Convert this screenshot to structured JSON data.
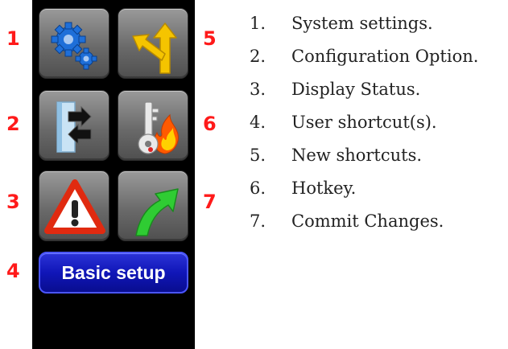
{
  "panel": {
    "buttons": [
      {
        "icon": "gears-icon",
        "number": "1"
      },
      {
        "icon": "split-arrow-icon",
        "number": "5"
      },
      {
        "icon": "transfer-arrows-icon",
        "number": "2"
      },
      {
        "icon": "key-fire-icon",
        "number": "6"
      },
      {
        "icon": "warning-icon",
        "number": "3"
      },
      {
        "icon": "green-arrow-icon",
        "number": "7"
      }
    ],
    "basic_setup": {
      "label": "Basic setup",
      "number": "4"
    }
  },
  "legend": [
    {
      "index": "1.",
      "text": "System settings."
    },
    {
      "index": "2.",
      "text": "Configuration Option."
    },
    {
      "index": "3.",
      "text": "Display Status."
    },
    {
      "index": "4.",
      "text": "User shortcut(s)."
    },
    {
      "index": "5.",
      "text": "New shortcuts."
    },
    {
      "index": "6.",
      "text": "Hotkey."
    },
    {
      "index": "7.",
      "text": "Commit Changes."
    }
  ],
  "colors": {
    "panel": "#000000",
    "tile": "#7a7a7a",
    "label_number": "#ff1a1a",
    "basic_button": "#1016b8"
  }
}
